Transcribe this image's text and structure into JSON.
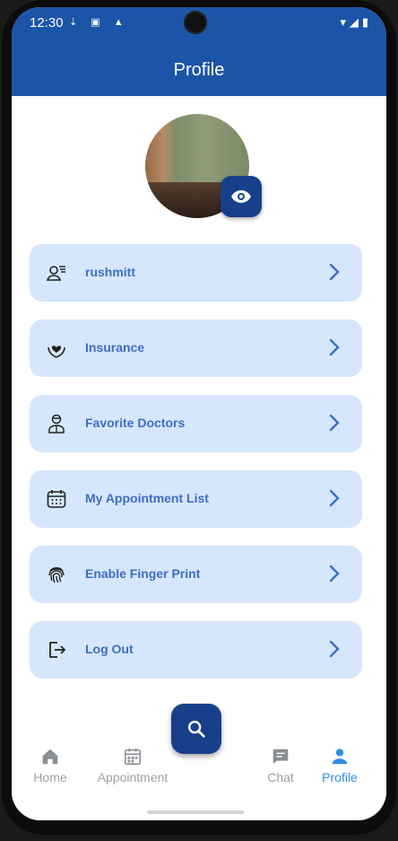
{
  "status_bar": {
    "time": "12:30",
    "left_icons": "⇣ ▣ ▲",
    "right_icons": "▾◢▮"
  },
  "app_bar": {
    "title": "Profile"
  },
  "profile": {
    "avatar_alt": "profile-photo",
    "view_icon": "eye-icon"
  },
  "menu": [
    {
      "label": "rushmitt",
      "icon": "user-list-icon"
    },
    {
      "label": "Insurance",
      "icon": "heart-hand-icon"
    },
    {
      "label": "Favorite Doctors",
      "icon": "doctor-icon"
    },
    {
      "label": "My Appointment List",
      "icon": "calendar-icon"
    },
    {
      "label": "Enable Finger Print",
      "icon": "fingerprint-icon"
    },
    {
      "label": "Log Out",
      "icon": "logout-icon"
    }
  ],
  "fab": {
    "icon": "search-icon"
  },
  "bottom_nav": [
    {
      "label": "Home",
      "icon": "home-icon",
      "active": false
    },
    {
      "label": "Appointment",
      "icon": "calendar-icon",
      "active": false
    },
    {
      "label": "Chat",
      "icon": "chat-icon",
      "active": false
    },
    {
      "label": "Profile",
      "icon": "person-icon",
      "active": true
    }
  ],
  "colors": {
    "primary": "#1c55a8",
    "fab": "#17408a",
    "card_bg": "#d6e6fd",
    "card_text": "#3c6ec6",
    "nav_active": "#2e8ee6",
    "nav_inactive": "#9aa0a6"
  }
}
